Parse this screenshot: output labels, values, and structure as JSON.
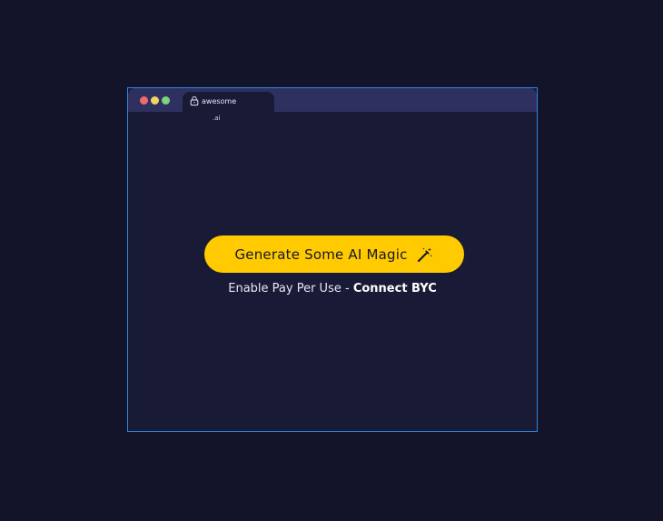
{
  "window": {
    "tab": {
      "title": "awesome",
      "domain": ".ai",
      "lock_icon": "lock-icon"
    }
  },
  "main": {
    "cta_label": "Generate Some AI Magic",
    "cta_icon": "magic-wand-icon",
    "subtext_prefix": "Enable Pay Per Use - ",
    "subtext_link": "Connect BYC"
  },
  "colors": {
    "background": "#13142a",
    "window": "#191a35",
    "titlebar": "#2e3060",
    "border": "#2f86e0",
    "accent": "#ffcb00"
  }
}
